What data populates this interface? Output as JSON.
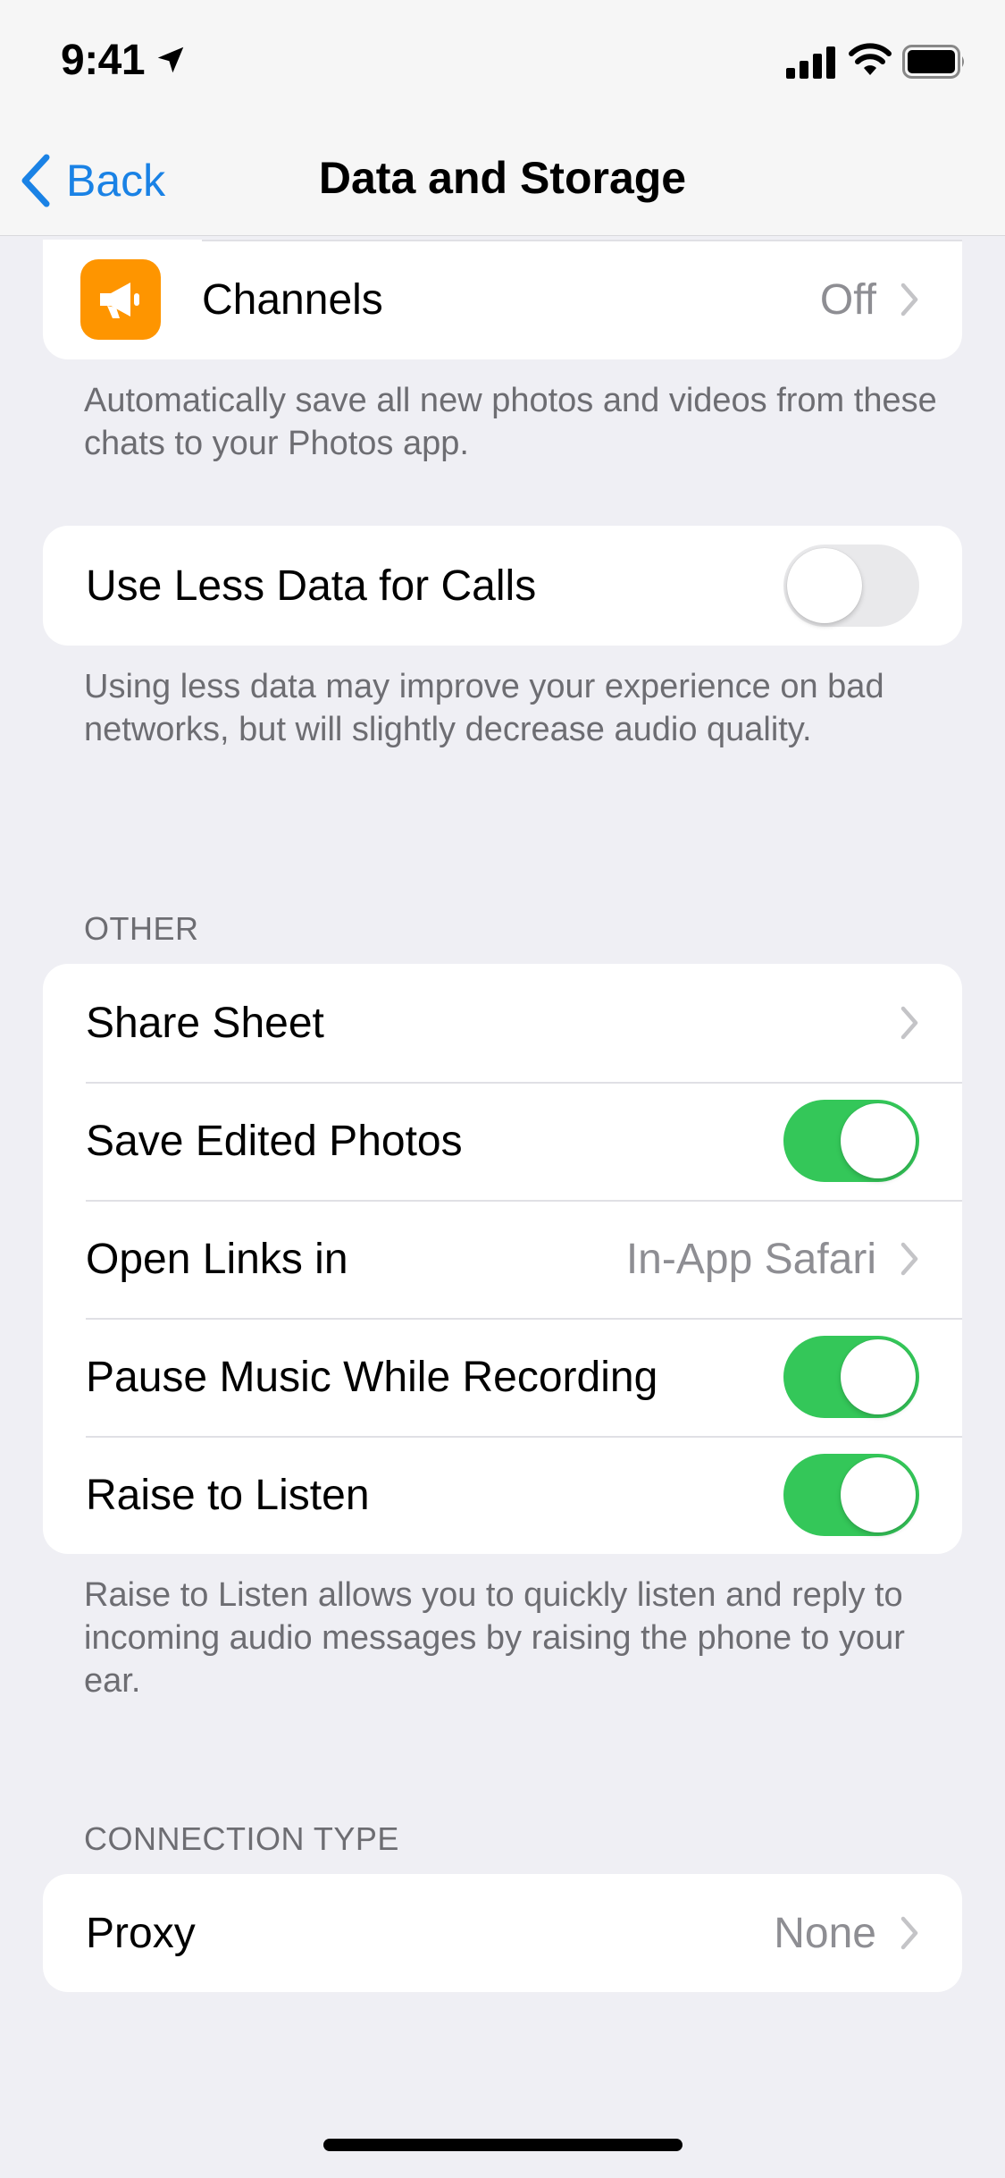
{
  "status": {
    "time": "9:41"
  },
  "nav": {
    "back_label": "Back",
    "title": "Data and Storage"
  },
  "autosave_group": {
    "channels_label": "Channels",
    "channels_value": "Off",
    "footer": "Automatically save all new photos and videos from these chats to your Photos app."
  },
  "calls_group": {
    "label": "Use Less Data for Calls",
    "toggle_on": false,
    "footer": "Using less data may improve your experience on bad networks, but will slightly decrease audio quality."
  },
  "other": {
    "header": "OTHER",
    "share_sheet": "Share Sheet",
    "save_edited_photos": "Save Edited Photos",
    "open_links_in": "Open Links in",
    "open_links_value": "In-App Safari",
    "pause_music": "Pause Music While Recording",
    "raise_to_listen": "Raise to Listen",
    "footer": "Raise to Listen allows you to quickly listen and reply to incoming audio messages by raising the phone to your ear."
  },
  "connection": {
    "header": "CONNECTION TYPE",
    "proxy_label": "Proxy",
    "proxy_value": "None"
  },
  "colors": {
    "accent": "#1a82e5",
    "toggle_on": "#34c759",
    "channels_icon": "#fe9500"
  }
}
